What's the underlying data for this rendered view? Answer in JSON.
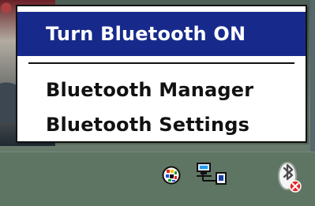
{
  "menu": {
    "items": [
      {
        "label": "Turn Bluetooth ON",
        "selected": true
      },
      {
        "label": "Bluetooth Manager",
        "selected": false
      },
      {
        "label": "Bluetooth Settings",
        "selected": false
      }
    ]
  },
  "tray": {
    "icons": [
      {
        "name": "color-globe-icon",
        "interactable": true
      },
      {
        "name": "network-connection-icon",
        "interactable": true
      },
      {
        "name": "bluetooth-off-icon",
        "interactable": true
      }
    ]
  },
  "colors": {
    "selected_background": "#172a8c",
    "selected_text": "#ffffff",
    "menu_text": "#111111",
    "menu_background": "#ffffff",
    "taskbar_background": "#5f7563"
  }
}
